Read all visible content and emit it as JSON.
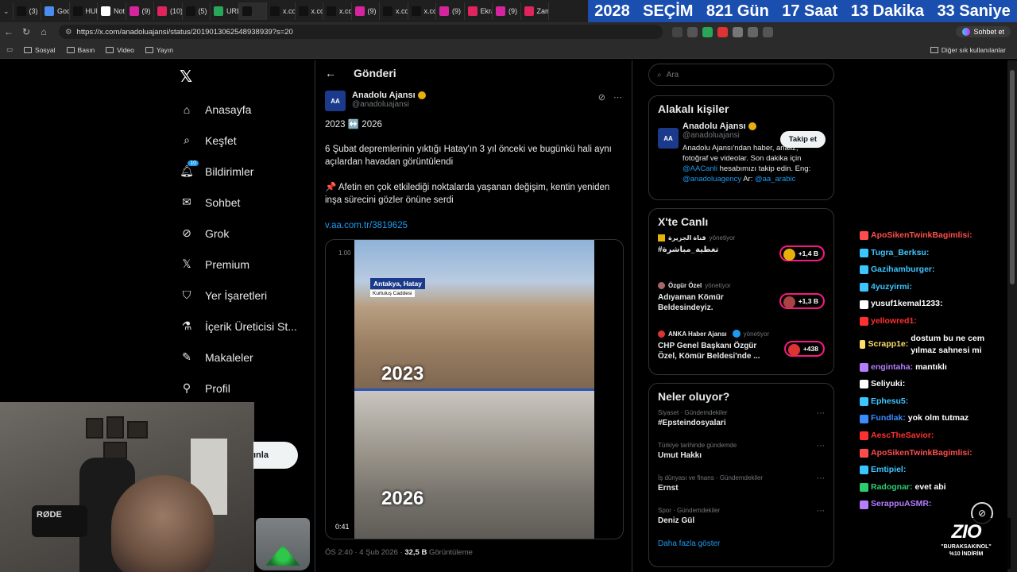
{
  "browser": {
    "tabs": [
      {
        "label": "(3)",
        "color": "#111"
      },
      {
        "label": "Goo",
        "color": "#4a8cf0"
      },
      {
        "label": "HUF",
        "color": "#111"
      },
      {
        "label": "Not",
        "color": "#fff"
      },
      {
        "label": "(9)",
        "color": "#d6249f"
      },
      {
        "label": "(10)",
        "color": "#e0245e"
      },
      {
        "label": "(5)",
        "color": "#111"
      },
      {
        "label": "URL",
        "color": "#2aa65a"
      },
      {
        "label": "",
        "color": "#111"
      },
      {
        "label": "x.co",
        "color": "#111"
      },
      {
        "label": "x.co",
        "color": "#111"
      },
      {
        "label": "x.co",
        "color": "#111"
      },
      {
        "label": "(9)",
        "color": "#d6249f"
      },
      {
        "label": "x.co",
        "color": "#111"
      },
      {
        "label": "x.co",
        "color": "#111"
      },
      {
        "label": "(9)",
        "color": "#d6249f"
      },
      {
        "label": "Ekra",
        "color": "#e0245e"
      },
      {
        "label": "(9)",
        "color": "#d6249f"
      },
      {
        "label": "Zam",
        "color": "#e0245e"
      }
    ],
    "url": "https://x.com/anadoluajansi/status/2019013062548938939?s=20",
    "profile_label": "Sohbet et",
    "bookmarks": [
      "Sosyal",
      "Basın",
      "Video",
      "Yayın"
    ],
    "bookmarks_right": "Diğer sık kullanılanlar"
  },
  "countdown": {
    "year": "2028",
    "label": "SEÇİM",
    "days": "821 Gün",
    "hours": "17 Saat",
    "minutes": "13 Dakika",
    "seconds": "33 Saniye"
  },
  "sidebar": {
    "items": [
      {
        "label": "Anasayfa",
        "icon": "home-icon"
      },
      {
        "label": "Keşfet",
        "icon": "search-icon"
      },
      {
        "label": "Bildirimler",
        "icon": "bell-icon",
        "badge": "10"
      },
      {
        "label": "Sohbet",
        "icon": "mail-icon"
      },
      {
        "label": "Grok",
        "icon": "grok-icon"
      },
      {
        "label": "Premium",
        "icon": "x-icon"
      },
      {
        "label": "Yer İşaretleri",
        "icon": "bookmark-icon"
      },
      {
        "label": "İçerik Üreticisi St...",
        "icon": "flask-icon"
      },
      {
        "label": "Makaleler",
        "icon": "article-icon"
      },
      {
        "label": "Profil",
        "icon": "person-icon"
      }
    ],
    "post_button_partial": "ınla"
  },
  "post": {
    "header": "Gönderi",
    "author_name": "Anadolu Ajansı",
    "author_handle": "@anadoluajansi",
    "avatar_text": "AA",
    "line1": "2023 ↔️ 2026",
    "line2": "6 Şubat depremlerinin yıktığı Hatay'ın 3 yıl önceki ve bugünkü hali aynı açılardan havadan görüntülendi",
    "line3": "📌 Afetin en çok etkilediği noktalarda yaşanan değişim, kentin yeniden inşa sürecini gözler önüne serdi",
    "link": "v.aa.com.tr/3819625",
    "video": {
      "speed": "1.00",
      "location": "Antakya, Hatay",
      "sublocation": "Kurtuluş Caddesi",
      "year_top": "2023",
      "year_bottom": "2026",
      "duration": "0:41"
    },
    "time": "ÖS 2:40 · 4 Şub 2026 ·",
    "views": "32,5 B",
    "views_label": "Görüntüleme"
  },
  "right": {
    "search_placeholder": "Ara",
    "related_title": "Alakalı kişiler",
    "related": {
      "name": "Anadolu Ajansı",
      "handle": "@anadoluajansi",
      "follow": "Takip et",
      "bio1": "Anadolu Ajansı'ndan haber, analiz, fotoğraf ve videolar. Son dakika için",
      "bio_link1": "@AACanli",
      "bio2": "hesabımızı takip edin. Eng:",
      "bio_link2": "@anadoluagency",
      "bio3": "Ar:",
      "bio_link3": "@aa_arabic"
    },
    "live_title": "X'te Canlı",
    "live": [
      {
        "host": "قناة الجزيرة",
        "role": "yönetiyor",
        "title": "#تغطية_مباشرة",
        "count": "+1,4 B"
      },
      {
        "host": "Özgür Özel",
        "role": "yönetiyor",
        "title": "Adıyaman Kömür Beldesindeyiz.",
        "count": "+1,3 B"
      },
      {
        "host": "ANKA Haber Ajansı",
        "role": "yönetiyor",
        "title": "CHP Genel Başkanı Özgür Özel, Kömür Beldesi'nde ...",
        "count": "+438"
      }
    ],
    "trends_title": "Neler oluyor?",
    "trends": [
      {
        "context": "Siyaset · Gündemdekiler",
        "name": "#Epsteindosyalari"
      },
      {
        "context": "Türkiye tarihinde gündemde",
        "name": "Umut Hakkı"
      },
      {
        "context": "İş dünyası ve finans · Gündemdekiler",
        "name": "Ernst"
      },
      {
        "context": "Spor · Gündemdekiler",
        "name": "Deniz Gül"
      }
    ],
    "show_more": "Daha fazla göster"
  },
  "chat": [
    {
      "user": "ApoSikenTwinkBagimlisi:",
      "msg": "",
      "color": "#ff4d4d"
    },
    {
      "user": "Tugra_Berksu:",
      "msg": "",
      "color": "#3cc6ff"
    },
    {
      "user": "Gazihamburger:",
      "msg": "",
      "color": "#3cc6ff"
    },
    {
      "user": "4yuzyirmi:",
      "msg": "",
      "color": "#3cc6ff"
    },
    {
      "user": "yusuf1kemal1233:",
      "msg": "",
      "color": "#ffffff"
    },
    {
      "user": "yellowred1:",
      "msg": "",
      "color": "#ff3030"
    },
    {
      "user": "Scrapp1e:",
      "msg": "dostum bu ne cem yılmaz sahnesi mi",
      "color": "#ffde6b"
    },
    {
      "user": "engintaha:",
      "msg": "mantıklı",
      "color": "#b57dff"
    },
    {
      "user": "Seliyuki:",
      "msg": "",
      "color": "#ffffff"
    },
    {
      "user": "Ephesu5:",
      "msg": "",
      "color": "#3cc6ff"
    },
    {
      "user": "Fundlak:",
      "msg": "yok olm tutmaz",
      "color": "#3c8cff"
    },
    {
      "user": "AescTheSavior:",
      "msg": "",
      "color": "#ff3030"
    },
    {
      "user": "ApoSikenTwinkBagimlisi:",
      "msg": "",
      "color": "#ff4d4d"
    },
    {
      "user": "Emtipiel:",
      "msg": "",
      "color": "#3cc6ff"
    },
    {
      "user": "Radognar:",
      "msg": "evet abi",
      "color": "#2ecc71"
    },
    {
      "user": "SerappuASMR:",
      "msg": "",
      "color": "#b57dff"
    }
  ],
  "overlay": {
    "mic_brand": "RØDE",
    "sponsor_logo": "ZIO",
    "sponsor_code": "\"BURAKSAKINOL\"",
    "sponsor_offer": "%10 İNDİRİM"
  }
}
